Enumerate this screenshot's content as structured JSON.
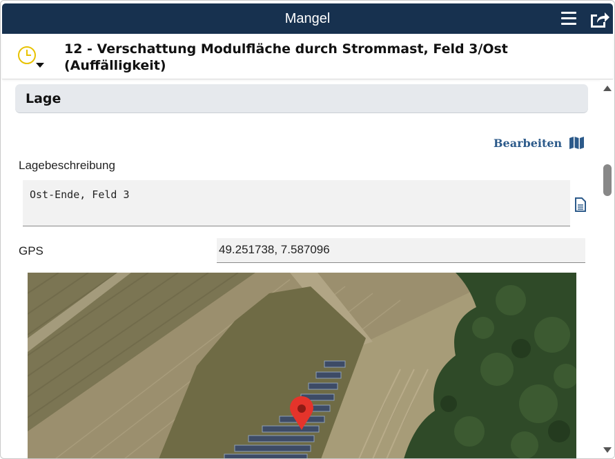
{
  "window": {
    "title": "Mangel"
  },
  "header": {
    "title": "12 - Verschattung Modulfläche durch Strommast, Feld 3/Ost (Auffälligkeit)",
    "status_icon": "clock-icon"
  },
  "section": {
    "title": "Lage"
  },
  "actions": {
    "edit_label": "Bearbeiten",
    "edit_icon": "map-icon"
  },
  "location": {
    "description_label": "Lagebeschreibung",
    "description_value": "Ost-Ende, Feld 3",
    "gps_label": "GPS",
    "gps_value": "49.251738, 7.587096"
  },
  "colors": {
    "titlebar": "#17314f",
    "accent": "#2c5a8a",
    "clock": "#e8c200",
    "marker": "#e5342b"
  }
}
